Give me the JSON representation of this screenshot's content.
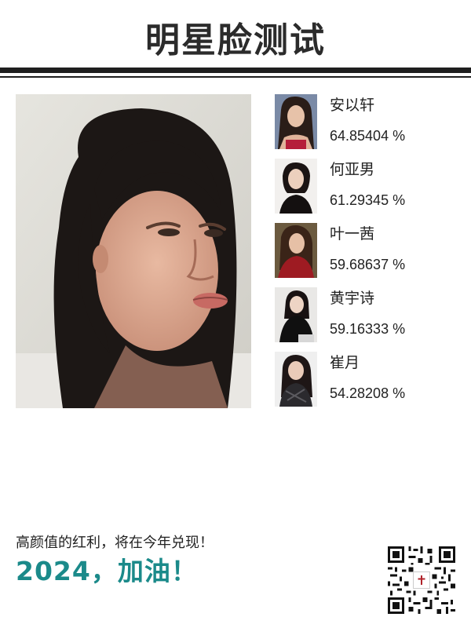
{
  "header": {
    "title": "明星脸测试"
  },
  "colors": {
    "title": "#2b2b2b",
    "rule": "#1f1f1f",
    "accent_teal": "#1b8a8a",
    "text": "#222222"
  },
  "matches": [
    {
      "name": "安以轩",
      "score": "64.85404 %"
    },
    {
      "name": "何亚男",
      "score": "61.29345 %"
    },
    {
      "name": "叶一茜",
      "score": "59.68637 %"
    },
    {
      "name": "黄宇诗",
      "score": "59.16333 %"
    },
    {
      "name": "崔月",
      "score": "54.28208 %"
    }
  ],
  "footer": {
    "slogan": "高颜值的红利，将在今年兑现！",
    "headline": "2024，加油！"
  }
}
